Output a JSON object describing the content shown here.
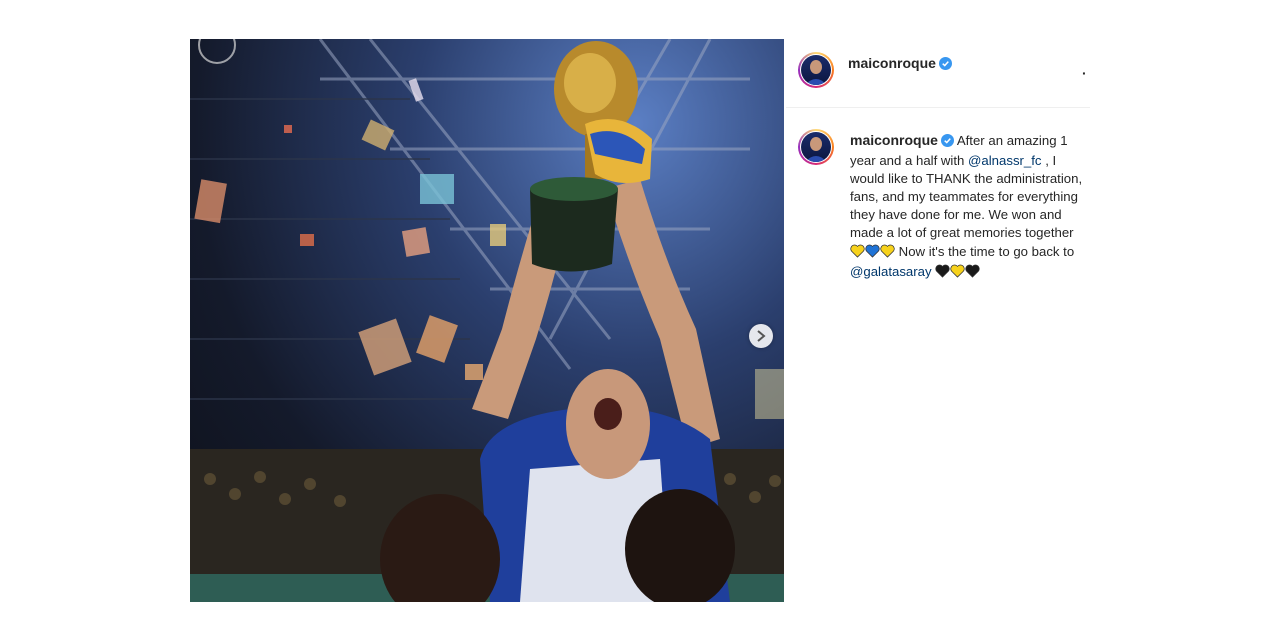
{
  "post": {
    "image_alt": "Player lifting golden trophy celebrating with teammates",
    "carousel_next_icon": "chevron-right-icon"
  },
  "header": {
    "username": "maiconroque",
    "verified_icon": "verified-badge-icon",
    "more_icon": "more-options-icon"
  },
  "caption": {
    "username": "maiconroque",
    "text_1": " After an amazing 1 year and a half with ",
    "mention_1": "@alnassr_fc",
    "text_2": " , I would like to THANK the administration, fans, and my teammates for everything they have done for me. We won and made a lot of great memories together ",
    "hearts_1": [
      "yellow",
      "blue",
      "yellow"
    ],
    "text_3": " Now it's the time to go back to ",
    "mention_2": "@galatasaray",
    "hearts_2": [
      "black",
      "yellow",
      "black"
    ]
  },
  "colors": {
    "yellow_heart": "#f7d21c",
    "blue_heart": "#1f73d6",
    "black_heart": "#1a1a1a",
    "verified": "#3897f0",
    "mention": "#00376b"
  }
}
